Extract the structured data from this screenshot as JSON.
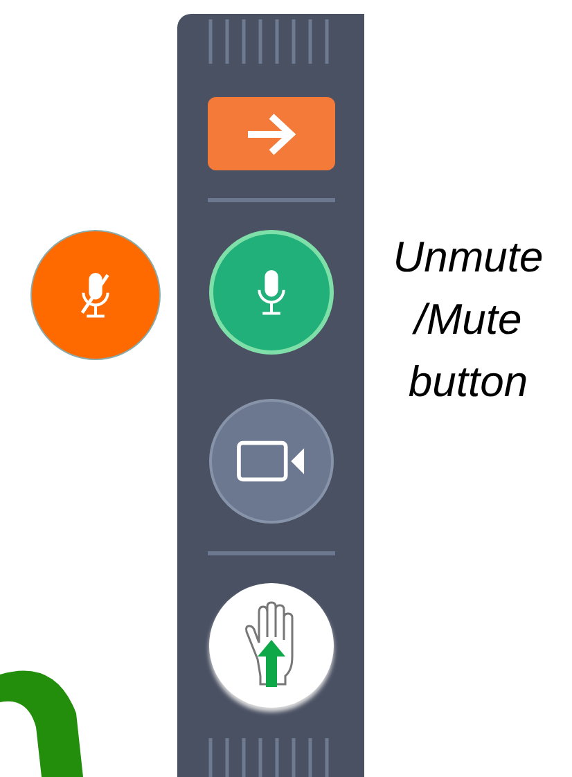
{
  "muted_indicator": {
    "muted": true
  },
  "toolbar": {
    "buttons": [
      {
        "kind": "arrow"
      },
      {
        "kind": "mic",
        "muted": false
      },
      {
        "kind": "camera"
      },
      {
        "kind": "hand"
      }
    ]
  },
  "caption": "Unmute /Mute button"
}
